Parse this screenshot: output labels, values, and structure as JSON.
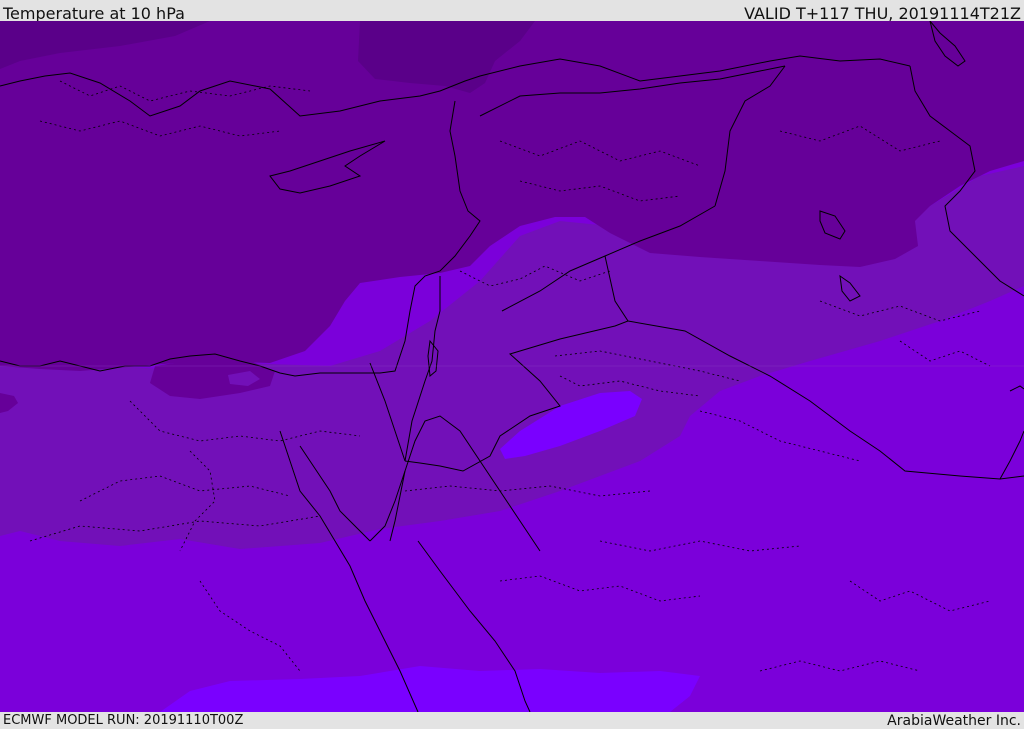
{
  "header": {
    "title": "Temperature at 10 hPa",
    "valid_time": "VALID T+117 THU, 20191114T21Z"
  },
  "footer": {
    "model_run": "ECMWF MODEL RUN: 20191110T00Z",
    "credit": "ArabiaWeather Inc."
  },
  "map": {
    "variable": "temperature",
    "level": "10 hPa",
    "fill_colors": {
      "coldest_band": "#7a00ff",
      "cold_band": "#7b00da",
      "mid_band": "#7210b8",
      "warm_band": "#660099",
      "warmest_band": "#5a0089"
    },
    "boundary_color": "#000000",
    "boundary_styles": [
      "solid country borders",
      "dotted internal borders"
    ]
  }
}
